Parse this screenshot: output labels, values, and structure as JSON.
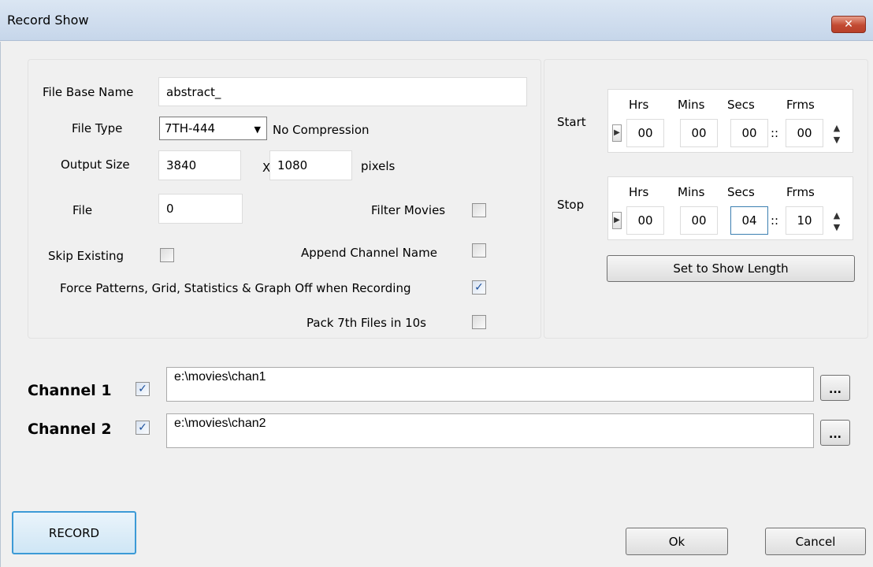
{
  "window": {
    "title": "Record Show",
    "close_glyph": "✕"
  },
  "file": {
    "base_name_label": "File Base Name",
    "base_name_value": "abstract_",
    "type_label": "File Type",
    "type_value": "7TH-444",
    "type_note": "No Compression",
    "output_size_label": "Output Size",
    "width": "3840",
    "x_sep": "X",
    "height": "1080",
    "unit": "pixels",
    "file_label": "File",
    "file_value": "0"
  },
  "options": {
    "filter_movies": {
      "label": "Filter Movies",
      "checked": false
    },
    "skip_existing": {
      "label": "Skip Existing",
      "checked": false
    },
    "append_channel_name": {
      "label": "Append Channel Name",
      "checked": false
    },
    "force_off": {
      "label": "Force Patterns, Grid, Statistics & Graph Off when Recording",
      "checked": true
    },
    "pack_7th": {
      "label": "Pack 7th Files in 10s",
      "checked": false
    }
  },
  "timecode": {
    "headers": {
      "hrs": "Hrs",
      "mins": "Mins",
      "secs": "Secs",
      "frms": "Frms"
    },
    "sep": "::",
    "start": {
      "label": "Start",
      "hrs": "00",
      "mins": "00",
      "secs": "00",
      "frms": "00"
    },
    "stop": {
      "label": "Stop",
      "hrs": "00",
      "mins": "00",
      "secs": "04",
      "frms": "10"
    },
    "set_length_label": "Set to Show Length"
  },
  "channels": [
    {
      "label": "Channel 1",
      "checked": true,
      "path": "e:\\movies\\chan1",
      "browse": "..."
    },
    {
      "label": "Channel 2",
      "checked": true,
      "path": "e:\\movies\\chan2",
      "browse": "..."
    }
  ],
  "buttons": {
    "record": "RECORD",
    "ok": "Ok",
    "cancel": "Cancel"
  },
  "icons": {
    "check": "✓",
    "dropdown": "▼",
    "play": "▶",
    "spin_up": "▲",
    "spin_down": "▼"
  }
}
